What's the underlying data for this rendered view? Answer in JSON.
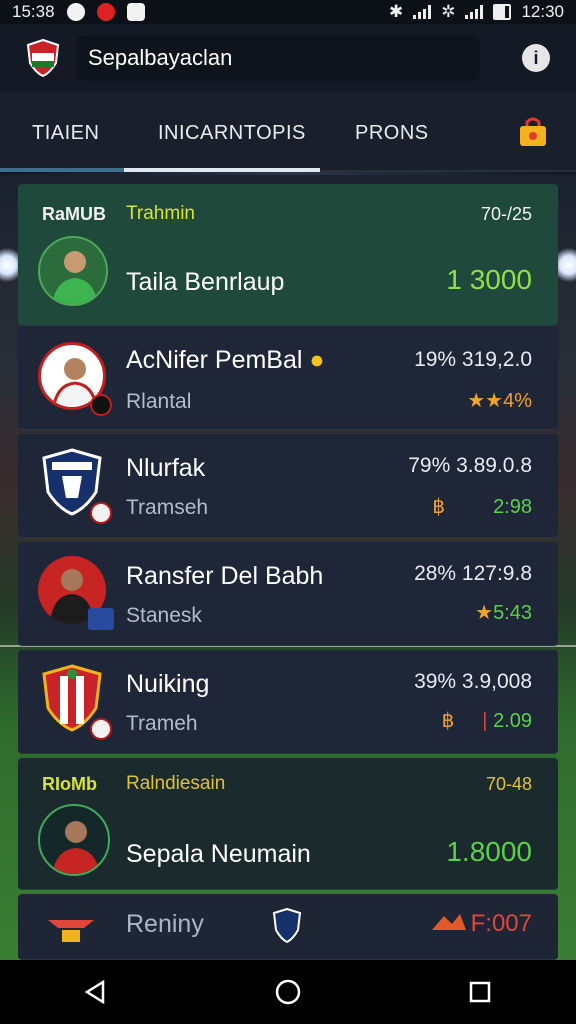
{
  "status_bar": {
    "time_left": "15:38",
    "time_right": "12:30"
  },
  "app_bar": {
    "search_value": "Sepalbayaclan"
  },
  "tabs": [
    {
      "label": "TIAIEN"
    },
    {
      "label": "INICARNTOPIS"
    },
    {
      "label": "PRONS"
    }
  ],
  "featured_top": {
    "left_label": "RaMUB",
    "mid_label": "Trahmin",
    "right_label": "70-/25",
    "name": "Taila Benrlaup",
    "value": "1 3000"
  },
  "rows": [
    {
      "name": "AcNifer PemBal",
      "sub": "Rlantal",
      "stat": "19% 319,2.0",
      "pts": "4%",
      "pts_prefix": "★★"
    },
    {
      "name": "Nlurfak",
      "sub": "Tramseh",
      "stat": "79% 3.89.0.8",
      "pts": "2:98",
      "pts_prefix": "฿"
    },
    {
      "name": "Ransfer Del Babh",
      "sub": "Stanesk",
      "stat": "28% 127:9.8",
      "pts": "5:43",
      "pts_prefix": "★"
    },
    {
      "name": "Nuiking",
      "sub": "Trameh",
      "stat": "39% 3.9,008",
      "pts": "2.09",
      "pts_prefix": "฿"
    }
  ],
  "featured_bottom": {
    "left_label": "RIoMb",
    "mid_label": "Ralndiesain",
    "right_label": "70-48",
    "name": "Sepala Neumain",
    "value": "1.8000"
  },
  "partial_row": {
    "name": "Reniny",
    "value": "F:007"
  },
  "colors": {
    "accent_green": "#5ad14a",
    "accent_yellow": "#d7e23a",
    "star_orange": "#f2a22a",
    "card_bg": "#1e2637",
    "featured_bg": "#1f4a3b",
    "danger_red": "#e0463a"
  },
  "icons": {
    "info": "info-icon",
    "action": "shopping-bag-icon",
    "nav": [
      "back-icon",
      "home-icon",
      "recents-icon"
    ]
  }
}
